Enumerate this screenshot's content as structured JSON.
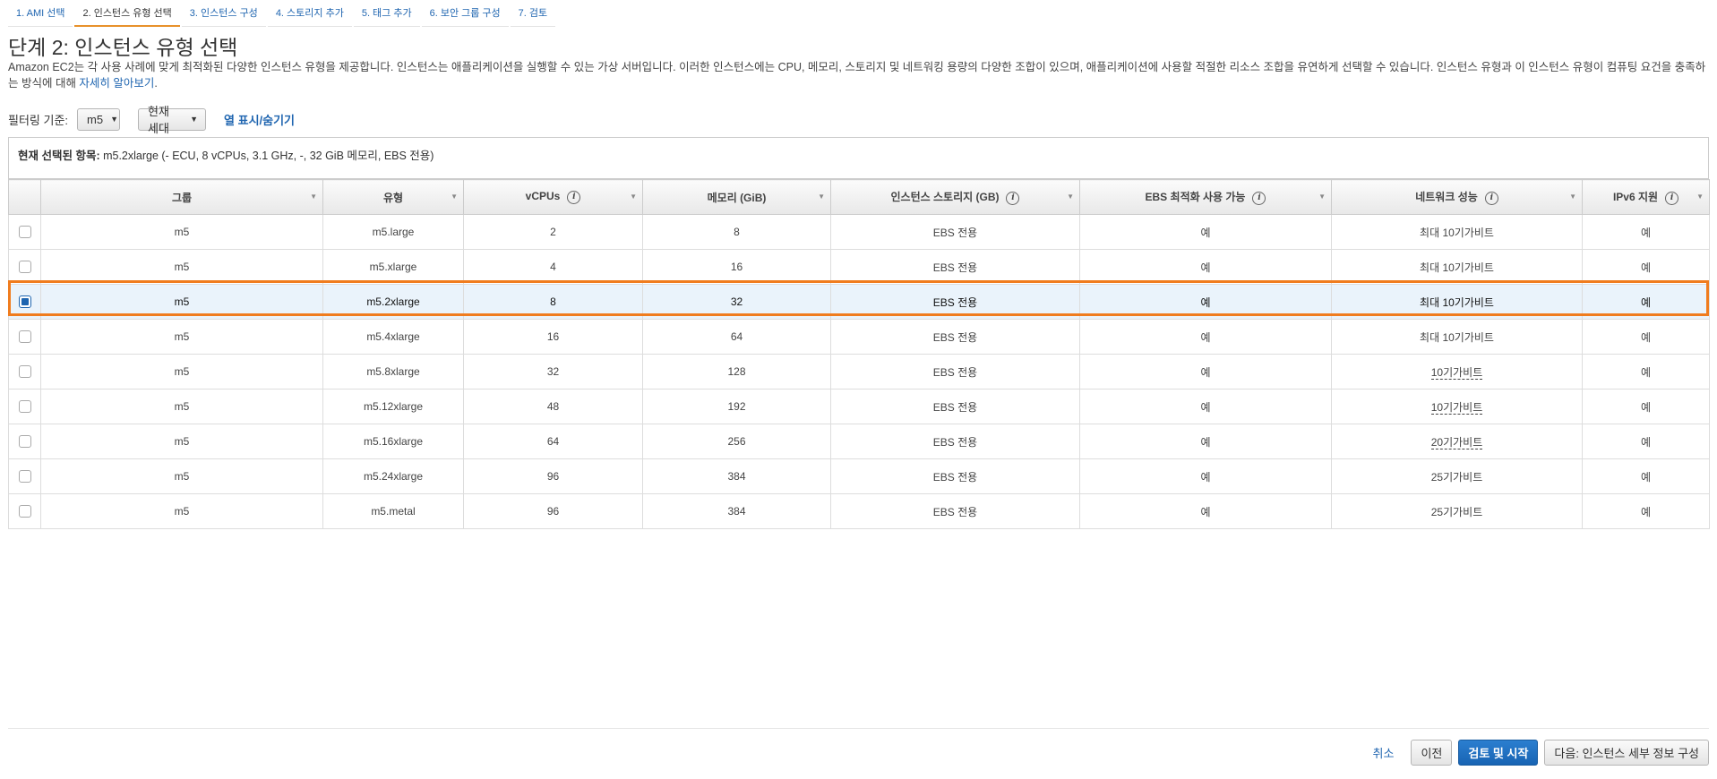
{
  "wizard_tabs": [
    {
      "label": "1. AMI 선택"
    },
    {
      "label": "2. 인스턴스 유형 선택"
    },
    {
      "label": "3. 인스턴스 구성"
    },
    {
      "label": "4. 스토리지 추가"
    },
    {
      "label": "5. 태그 추가"
    },
    {
      "label": "6. 보안 그룹 구성"
    },
    {
      "label": "7. 검토"
    }
  ],
  "page": {
    "title": "단계 2: 인스턴스 유형 선택",
    "description": "Amazon EC2는 각 사용 사례에 맞게 최적화된 다양한 인스턴스 유형을 제공합니다. 인스턴스는 애플리케이션을 실행할 수 있는 가상 서버입니다. 이러한 인스턴스에는 CPU, 메모리, 스토리지 및 네트워킹 용량의 다양한 조합이 있으며, 애플리케이션에 사용할 적절한 리소스 조합을 유연하게 선택할 수 있습니다. 인스턴스 유형과 이 인스턴스 유형이 컴퓨팅 요건을 충족하는 방식에 대해 ",
    "learn_more": "자세히 알아보기",
    "description_end": "."
  },
  "filter": {
    "label": "필터링 기준:",
    "family_value": "m5",
    "generation_value": "현재 세대",
    "toggle_columns": "열 표시/숨기기"
  },
  "selected": {
    "label": "현재 선택된 항목:",
    "value": " m5.2xlarge (- ECU, 8 vCPUs, 3.1 GHz, -, 32 GiB 메모리, EBS 전용)"
  },
  "table": {
    "headers": {
      "group": "그룹",
      "type": "유형",
      "vcpus": "vCPUs",
      "memory": "메모리 (GiB)",
      "storage": "인스턴스 스토리지 (GB)",
      "ebs": "EBS 최적화 사용 가능",
      "network": "네트워크 성능",
      "ipv6": "IPv6 지원"
    },
    "info_glyph": "i",
    "rows": [
      {
        "group": "m5",
        "type": "m5.large",
        "vcpus": "2",
        "memory": "8",
        "storage": "EBS 전용",
        "ebs": "예",
        "network": "최대 10기가비트",
        "ipv6": "예",
        "selected": false
      },
      {
        "group": "m5",
        "type": "m5.xlarge",
        "vcpus": "4",
        "memory": "16",
        "storage": "EBS 전용",
        "ebs": "예",
        "network": "최대 10기가비트",
        "ipv6": "예",
        "selected": false
      },
      {
        "group": "m5",
        "type": "m5.2xlarge",
        "vcpus": "8",
        "memory": "32",
        "storage": "EBS 전용",
        "ebs": "예",
        "network": "최대 10기가비트",
        "ipv6": "예",
        "selected": true
      },
      {
        "group": "m5",
        "type": "m5.4xlarge",
        "vcpus": "16",
        "memory": "64",
        "storage": "EBS 전용",
        "ebs": "예",
        "network": "최대 10기가비트",
        "ipv6": "예",
        "selected": false
      },
      {
        "group": "m5",
        "type": "m5.8xlarge",
        "vcpus": "32",
        "memory": "128",
        "storage": "EBS 전용",
        "ebs": "예",
        "network": "10기가비트",
        "ipv6": "예",
        "selected": false
      },
      {
        "group": "m5",
        "type": "m5.12xlarge",
        "vcpus": "48",
        "memory": "192",
        "storage": "EBS 전용",
        "ebs": "예",
        "network": "10기가비트",
        "ipv6": "예",
        "selected": false
      },
      {
        "group": "m5",
        "type": "m5.16xlarge",
        "vcpus": "64",
        "memory": "256",
        "storage": "EBS 전용",
        "ebs": "예",
        "network": "20기가비트",
        "ipv6": "예",
        "selected": false
      },
      {
        "group": "m5",
        "type": "m5.24xlarge",
        "vcpus": "96",
        "memory": "384",
        "storage": "EBS 전용",
        "ebs": "예",
        "network": "25기가비트",
        "ipv6": "예",
        "selected": false
      },
      {
        "group": "m5",
        "type": "m5.metal",
        "vcpus": "96",
        "memory": "384",
        "storage": "EBS 전용",
        "ebs": "예",
        "network": "25기가비트",
        "ipv6": "예",
        "selected": false
      }
    ]
  },
  "footer": {
    "cancel": "취소",
    "previous": "이전",
    "review_launch": "검토 및 시작",
    "next": "다음: 인스턴스 세부 정보 구성"
  },
  "colors": {
    "accent": "#1f65b0",
    "highlight_border": "#f07c1e",
    "active_tab_underline": "#e8912b",
    "selected_row": "#eaf3fb"
  }
}
